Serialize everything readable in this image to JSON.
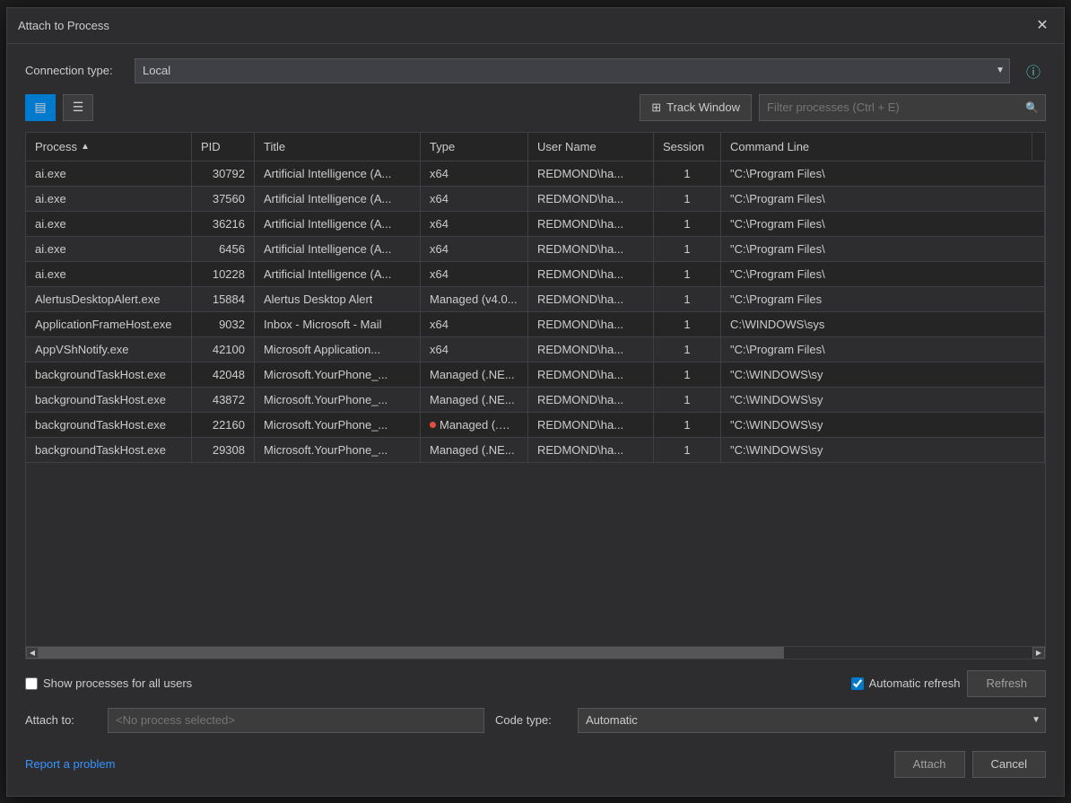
{
  "dialog": {
    "title": "Attach to Process",
    "close_label": "✕"
  },
  "connection": {
    "label": "Connection type:",
    "options": [
      "Local"
    ],
    "selected": "Local",
    "info_icon": "ⓘ"
  },
  "toolbar": {
    "view_list_icon": "☰",
    "view_detail_icon": "☰",
    "track_window_label": "Track Window",
    "track_window_icon": "⊞",
    "filter_placeholder": "Filter processes (Ctrl + E)",
    "filter_search_icon": "🔍"
  },
  "table": {
    "columns": [
      {
        "id": "process",
        "label": "Process",
        "sort": "asc"
      },
      {
        "id": "pid",
        "label": "PID",
        "sort": null
      },
      {
        "id": "title",
        "label": "Title",
        "sort": null
      },
      {
        "id": "type",
        "label": "Type",
        "sort": null
      },
      {
        "id": "username",
        "label": "User Name",
        "sort": null
      },
      {
        "id": "session",
        "label": "Session",
        "sort": null
      },
      {
        "id": "cmdline",
        "label": "Command Line",
        "sort": null
      }
    ],
    "rows": [
      {
        "process": "ai.exe",
        "pid": "30792",
        "title": "Artificial Intelligence (A...",
        "type": "x64",
        "username": "REDMOND\\ha...",
        "session": "1",
        "cmdline": "\"C:\\Program Files\\",
        "has_dot": false
      },
      {
        "process": "ai.exe",
        "pid": "37560",
        "title": "Artificial Intelligence (A...",
        "type": "x64",
        "username": "REDMOND\\ha...",
        "session": "1",
        "cmdline": "\"C:\\Program Files\\",
        "has_dot": false
      },
      {
        "process": "ai.exe",
        "pid": "36216",
        "title": "Artificial Intelligence (A...",
        "type": "x64",
        "username": "REDMOND\\ha...",
        "session": "1",
        "cmdline": "\"C:\\Program Files\\",
        "has_dot": false
      },
      {
        "process": "ai.exe",
        "pid": "6456",
        "title": "Artificial Intelligence (A...",
        "type": "x64",
        "username": "REDMOND\\ha...",
        "session": "1",
        "cmdline": "\"C:\\Program Files\\",
        "has_dot": false
      },
      {
        "process": "ai.exe",
        "pid": "10228",
        "title": "Artificial Intelligence (A...",
        "type": "x64",
        "username": "REDMOND\\ha...",
        "session": "1",
        "cmdline": "\"C:\\Program Files\\",
        "has_dot": false
      },
      {
        "process": "AlertusDesktopAlert.exe",
        "pid": "15884",
        "title": "Alertus Desktop Alert",
        "type": "Managed (v4.0...",
        "username": "REDMOND\\ha...",
        "session": "1",
        "cmdline": "\"C:\\Program Files",
        "has_dot": false
      },
      {
        "process": "ApplicationFrameHost.exe",
        "pid": "9032",
        "title": "Inbox - Microsoft - Mail",
        "type": "x64",
        "username": "REDMOND\\ha...",
        "session": "1",
        "cmdline": "C:\\WINDOWS\\sys",
        "has_dot": false
      },
      {
        "process": "AppVShNotify.exe",
        "pid": "42100",
        "title": "Microsoft Application...",
        "type": "x64",
        "username": "REDMOND\\ha...",
        "session": "1",
        "cmdline": "\"C:\\Program Files\\",
        "has_dot": false
      },
      {
        "process": "backgroundTaskHost.exe",
        "pid": "42048",
        "title": "Microsoft.YourPhone_...",
        "type": "Managed (.NE...",
        "username": "REDMOND\\ha...",
        "session": "1",
        "cmdline": "\"C:\\WINDOWS\\sy",
        "has_dot": false
      },
      {
        "process": "backgroundTaskHost.exe",
        "pid": "43872",
        "title": "Microsoft.YourPhone_...",
        "type": "Managed (.NE...",
        "username": "REDMOND\\ha...",
        "session": "1",
        "cmdline": "\"C:\\WINDOWS\\sy",
        "has_dot": false
      },
      {
        "process": "backgroundTaskHost.exe",
        "pid": "22160",
        "title": "Microsoft.YourPhone_...",
        "type": "Managed (.NE...",
        "username": "REDMOND\\ha...",
        "session": "1",
        "cmdline": "\"C:\\WINDOWS\\sy",
        "has_dot": true
      },
      {
        "process": "backgroundTaskHost.exe",
        "pid": "29308",
        "title": "Microsoft.YourPhone_...",
        "type": "Managed (.NE...",
        "username": "REDMOND\\ha...",
        "session": "1",
        "cmdline": "\"C:\\WINDOWS\\sy",
        "has_dot": false
      }
    ]
  },
  "bottom": {
    "show_all_label": "Show processes for all users",
    "auto_refresh_label": "Automatic refresh",
    "refresh_label": "Refresh"
  },
  "attach_to": {
    "label": "Attach to:",
    "placeholder": "<No process selected>",
    "value": ""
  },
  "code_type": {
    "label": "Code type:",
    "options": [
      "Automatic"
    ],
    "selected": "Automatic"
  },
  "footer": {
    "report_link": "Report a problem",
    "attach_label": "Attach",
    "cancel_label": "Cancel"
  }
}
